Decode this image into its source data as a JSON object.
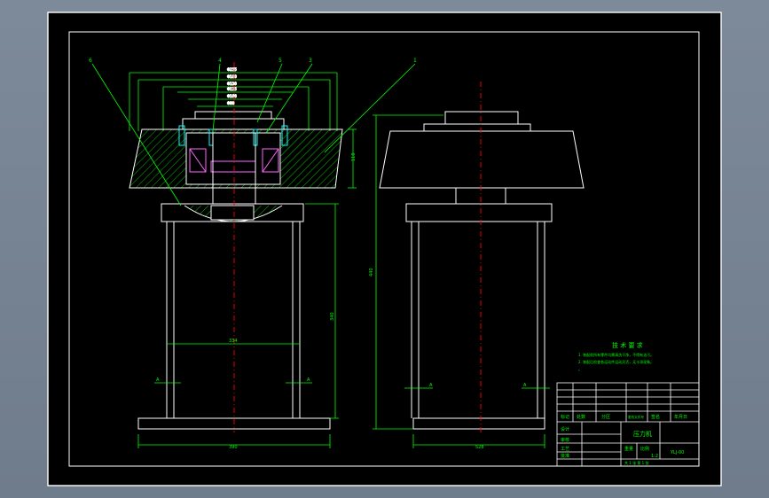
{
  "drawing": {
    "callouts": [
      "6",
      "4",
      "5",
      "3",
      "1"
    ],
    "dims_left": {
      "top_stack": [
        "Φ215",
        "Φ180",
        "Φ150",
        "Φ125",
        "Φ100",
        "Φ80"
      ],
      "side_right": [
        "110",
        "120"
      ],
      "height": "340",
      "base_width": "390",
      "inner_width": "334",
      "section_a": "A"
    },
    "dims_right": {
      "height": "440",
      "base_width": "528",
      "section_a": "A"
    },
    "tech_requirements": {
      "title": "技 术 要 求",
      "line1": "1. 装配前所有零件均需清洗干净，不得有油污。",
      "line2": "2. 装配后检查各运动件运动灵活，无卡滞现象。",
      "line3": "。"
    },
    "title_block": {
      "drawing_name": "压力机",
      "drawing_number": "YLJ-00",
      "scale": "1:2",
      "sheet": "共 1 张  第 1 张",
      "head_labels": [
        "标记",
        "处数",
        "分区",
        "更改文件号",
        "签名",
        "年月日"
      ],
      "signers": [
        "设计",
        "审核",
        "工艺",
        "批准"
      ],
      "weight_label": "重量",
      "scale_label": "比例"
    },
    "colors": {
      "background": "#000000",
      "frame": "#ffffff",
      "outline": "#ffffff",
      "dimension": "#00ff00",
      "centerline": "#ff0000",
      "hatch": "#00c000",
      "bearing": "#ff66ff",
      "bolt": "#00ffff",
      "callout": "#ffff00"
    }
  }
}
